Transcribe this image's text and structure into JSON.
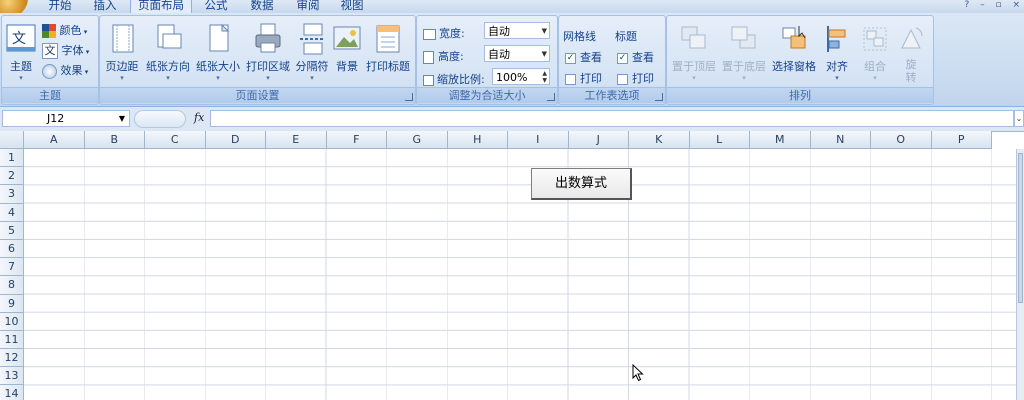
{
  "tabs": [
    {
      "label": "开始",
      "active": false
    },
    {
      "label": "插入",
      "active": false
    },
    {
      "label": "页面布局",
      "active": true
    },
    {
      "label": "公式",
      "active": false
    },
    {
      "label": "数据",
      "active": false
    },
    {
      "label": "审阅",
      "active": false
    },
    {
      "label": "视图",
      "active": false
    }
  ],
  "ribbon": {
    "themes": {
      "label": "主题",
      "main_button": "主题",
      "colors": "颜色",
      "fonts": "字体",
      "effects": "效果"
    },
    "page_setup": {
      "label": "页面设置",
      "buttons": [
        "页边距",
        "纸张方向",
        "纸张大小",
        "打印区域",
        "分隔符",
        "背景",
        "打印标题"
      ]
    },
    "scale_to_fit": {
      "label": "调整为合适大小",
      "width_label": "宽度:",
      "width_value": "自动",
      "height_label": "高度:",
      "height_value": "自动",
      "scale_label": "缩放比例:",
      "scale_value": "100%"
    },
    "sheet_options": {
      "label": "工作表选项",
      "gridlines_title": "网格线",
      "headings_title": "标题",
      "view": "查看",
      "print": "打印",
      "gridlines_view": true,
      "gridlines_print": false,
      "headings_view": true,
      "headings_print": false
    },
    "arrange": {
      "label": "排列",
      "buttons": [
        "置于顶层",
        "置于底层",
        "选择窗格",
        "对齐",
        "组合",
        "旋转"
      ]
    }
  },
  "formula_bar": {
    "name_box": "J12",
    "fx": "fx",
    "formula": ""
  },
  "sheet": {
    "columns": [
      "A",
      "B",
      "C",
      "D",
      "E",
      "F",
      "G",
      "H",
      "I",
      "J",
      "K",
      "L",
      "M",
      "N",
      "O",
      "P"
    ],
    "rows": [
      "1",
      "2",
      "3",
      "4",
      "5",
      "6",
      "7",
      "8",
      "9",
      "10",
      "11",
      "12",
      "13",
      "14"
    ],
    "button_label": "出数算式"
  },
  "colors": {
    "accent": "#15428b",
    "ribbon_bg": "#d4e3f4",
    "gridline": "#d0d7e5"
  }
}
